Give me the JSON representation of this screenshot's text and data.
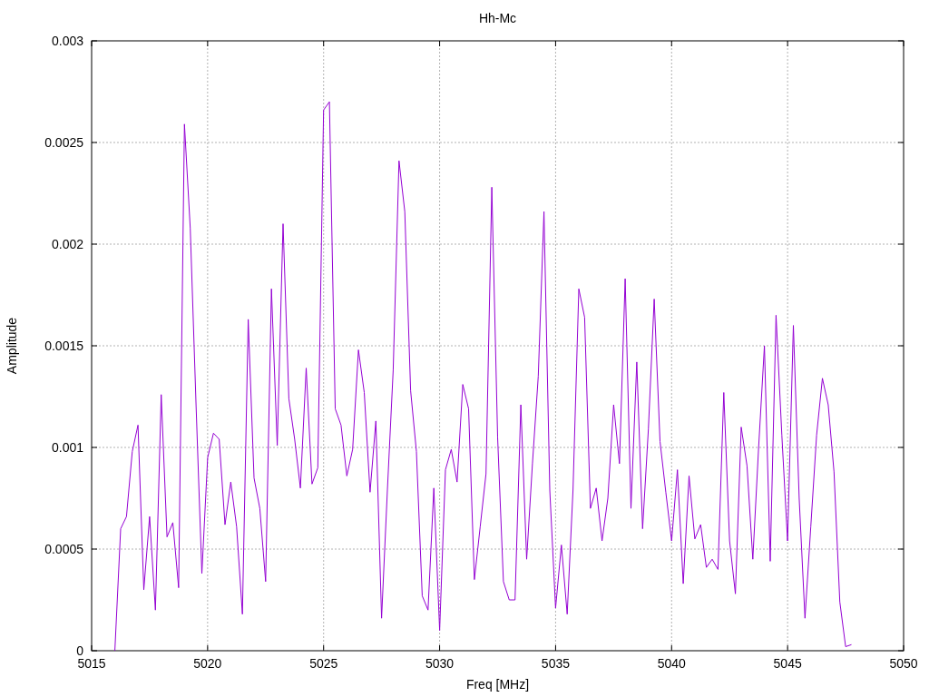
{
  "chart_data": {
    "type": "line",
    "grid": true,
    "title": "Hh-Mc",
    "xlabel": "Freq [MHz]",
    "ylabel": "Amplitude",
    "xlim": [
      5015,
      5050
    ],
    "ylim": [
      0,
      0.003
    ],
    "xticks": [
      5015,
      5020,
      5025,
      5030,
      5035,
      5040,
      5045,
      5050
    ],
    "yticks": [
      0,
      0.0005,
      0.001,
      0.0015,
      0.002,
      0.0025,
      0.003
    ],
    "x": [
      5016,
      5016.25,
      5016.5,
      5016.75,
      5017,
      5017.25,
      5017.5,
      5017.75,
      5018,
      5018.25,
      5018.5,
      5018.75,
      5019,
      5019.25,
      5019.5,
      5019.75,
      5020,
      5020.25,
      5020.5,
      5020.75,
      5021,
      5021.25,
      5021.5,
      5021.75,
      5022,
      5022.25,
      5022.5,
      5022.75,
      5023,
      5023.25,
      5023.5,
      5023.75,
      5024,
      5024.25,
      5024.5,
      5024.75,
      5025,
      5025.25,
      5025.5,
      5025.75,
      5026,
      5026.25,
      5026.5,
      5026.75,
      5027,
      5027.25,
      5027.5,
      5027.75,
      5028,
      5028.25,
      5028.5,
      5028.75,
      5029,
      5029.25,
      5029.5,
      5029.75,
      5030,
      5030.25,
      5030.5,
      5030.75,
      5031,
      5031.25,
      5031.5,
      5031.75,
      5032,
      5032.25,
      5032.5,
      5032.75,
      5033,
      5033.25,
      5033.5,
      5033.75,
      5034,
      5034.25,
      5034.5,
      5034.75,
      5035,
      5035.25,
      5035.5,
      5035.75,
      5036,
      5036.25,
      5036.5,
      5036.75,
      5037,
      5037.25,
      5037.5,
      5037.75,
      5038,
      5038.25,
      5038.5,
      5038.75,
      5039,
      5039.25,
      5039.5,
      5039.75,
      5040,
      5040.25,
      5040.5,
      5040.75,
      5041,
      5041.25,
      5041.5,
      5041.75,
      5042,
      5042.25,
      5042.5,
      5042.75,
      5043,
      5043.25,
      5043.5,
      5043.75,
      5044,
      5044.25,
      5044.5,
      5044.75,
      5045,
      5045.25,
      5045.5,
      5045.75,
      5046,
      5046.25,
      5046.5,
      5046.75,
      5047,
      5047.25,
      5047.5,
      5047.75
    ],
    "series": [
      {
        "color": "#9400d3",
        "values": [
          0,
          0.0006,
          0.00066,
          0.00098,
          0.00111,
          0.0003,
          0.00066,
          0.0002,
          0.00126,
          0.00056,
          0.00063,
          0.00031,
          0.00259,
          0.00208,
          0.00121,
          0.00038,
          0.00095,
          0.00107,
          0.00104,
          0.00062,
          0.00083,
          0.00061,
          0.00018,
          0.00163,
          0.00085,
          0.0007,
          0.00034,
          0.00178,
          0.00101,
          0.0021,
          0.00124,
          0.00104,
          0.0008,
          0.00139,
          0.00082,
          0.0009,
          0.00266,
          0.0027,
          0.00119,
          0.00111,
          0.00086,
          0.00099,
          0.00148,
          0.00127,
          0.00078,
          0.00113,
          0.00016,
          0.00079,
          0.00138,
          0.00241,
          0.00216,
          0.00128,
          0.00098,
          0.00027,
          0.0002,
          0.0008,
          0.0001,
          0.00089,
          0.00099,
          0.00083,
          0.00131,
          0.00119,
          0.00035,
          0.00061,
          0.00087,
          0.00228,
          0.00105,
          0.00034,
          0.00025,
          0.00025,
          0.00121,
          0.00045,
          0.00092,
          0.00135,
          0.00216,
          0.00079,
          0.00021,
          0.00052,
          0.00018,
          0.00079,
          0.00178,
          0.00164,
          0.0007,
          0.0008,
          0.00054,
          0.00075,
          0.00121,
          0.00092,
          0.00183,
          0.0007,
          0.00142,
          0.0006,
          0.00109,
          0.00173,
          0.00103,
          0.00078,
          0.00054,
          0.00089,
          0.00033,
          0.00086,
          0.00055,
          0.00062,
          0.00041,
          0.00045,
          0.0004,
          0.00127,
          0.00054,
          0.00028,
          0.0011,
          0.00091,
          0.00045,
          0.001,
          0.0015,
          0.00044,
          0.00165,
          0.00106,
          0.00054,
          0.0016,
          0.00075,
          0.00016,
          0.00061,
          0.00106,
          0.00134,
          0.00121,
          0.00088,
          0.00024,
          2e-05,
          3e-05
        ]
      }
    ]
  }
}
